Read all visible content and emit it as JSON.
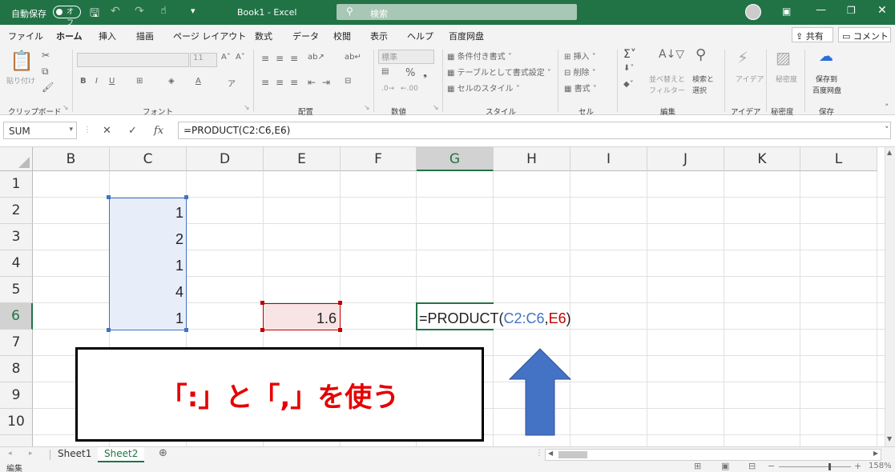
{
  "titlebar": {
    "autosave": "自動保存",
    "toggle": "オフ",
    "title": "Book1  -  Excel",
    "search": "検索"
  },
  "menu": [
    "ファイル",
    "ホーム",
    "挿入",
    "描画",
    "ページ レイアウト",
    "数式",
    "データ",
    "校閲",
    "表示",
    "ヘルプ",
    "百度网盘"
  ],
  "share": "共有",
  "comment": "コメント",
  "ribbon": {
    "groups": [
      "クリップボード",
      "フォント",
      "配置",
      "数値",
      "スタイル",
      "セル",
      "編集",
      "アイデア",
      "秘密度",
      "保存"
    ],
    "paste": "貼り付け",
    "font_size": "11",
    "number_format": "標準",
    "styles": [
      "条件付き書式",
      "テーブルとして書式設定",
      "セルのスタイル"
    ],
    "cells": [
      "挿入",
      "削除",
      "書式"
    ],
    "sort": "並べ替えと",
    "filter": "フィルター",
    "find": "検索と",
    "select": "選択",
    "ideas": "アイデア",
    "sensitivity": "秘密度",
    "save1": "保存到",
    "save2": "百度网盘"
  },
  "namebox": "SUM",
  "fx": "fx",
  "formula": "=PRODUCT(C2:C6,E6)",
  "columns": [
    "B",
    "C",
    "D",
    "E",
    "F",
    "G",
    "H",
    "I",
    "J",
    "K",
    "L"
  ],
  "rows": [
    "1",
    "2",
    "3",
    "4",
    "5",
    "6",
    "7",
    "8",
    "9",
    "10"
  ],
  "cells": {
    "C2": "1",
    "C3": "2",
    "C4": "1",
    "C5": "4",
    "C6": "1",
    "E6": "1.6"
  },
  "edit": {
    "p1": "=PRODUCT(",
    "p2": "C2:C6",
    "p3": ",",
    "p4": "E6",
    "p5": ")"
  },
  "callout": "「:」と「,」を使う",
  "sheets": [
    "Sheet1",
    "Sheet2"
  ],
  "status": {
    "mode": "編集",
    "zoom": "158%"
  },
  "colors": {
    "green": "#217346",
    "blue_range": "#4472c4",
    "red_range": "#c00000",
    "arrow": "#4472c4",
    "callout_text": "#e60000"
  }
}
